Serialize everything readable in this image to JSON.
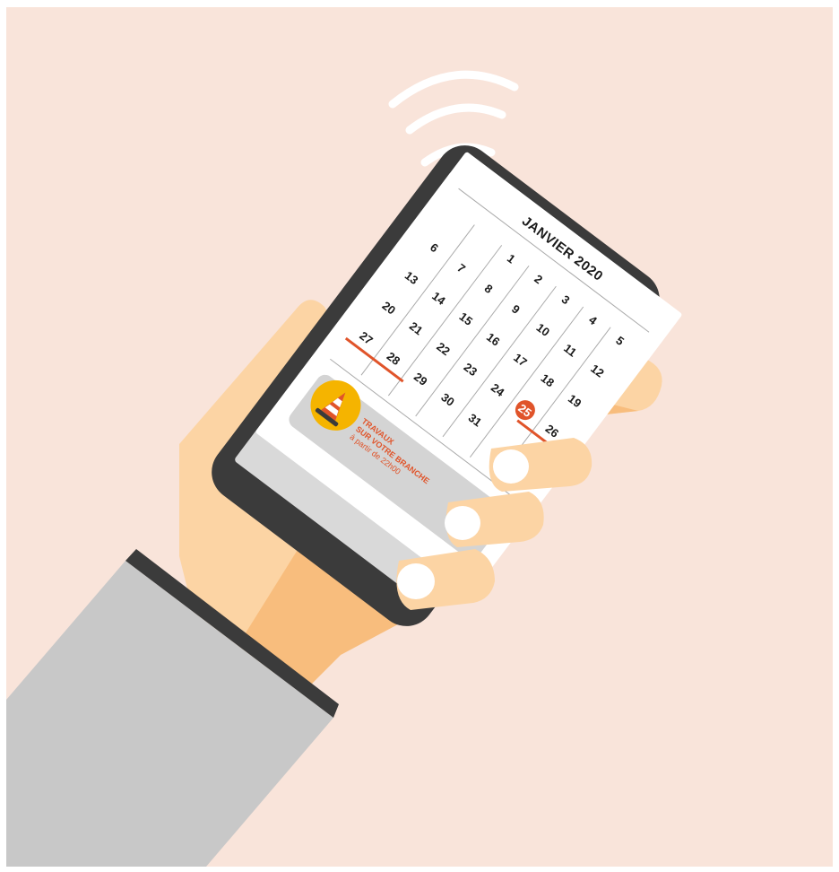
{
  "calendar": {
    "title": "JANVIER 2020",
    "selected_day": "25",
    "weeks": [
      [
        "",
        "",
        "1",
        "2",
        "3",
        "4",
        "5"
      ],
      [
        "6",
        "7",
        "8",
        "9",
        "10",
        "11",
        "12"
      ],
      [
        "13",
        "14",
        "15",
        "16",
        "17",
        "18",
        "19"
      ],
      [
        "20",
        "21",
        "22",
        "23",
        "24",
        "25",
        "26"
      ],
      [
        "27",
        "28",
        "29",
        "30",
        "31",
        "",
        ""
      ]
    ]
  },
  "notification": {
    "line1": "TRAVAUX",
    "line2": "SUR VOTRE BRANCHE",
    "line3": "à partir de 22h00",
    "icon": "traffic-cone-icon"
  },
  "colors": {
    "background": "#f9e4da",
    "phone_body": "#3b3b3b",
    "accent": "#e0542a",
    "cone_circle": "#f5b400",
    "skin": "#fcd4a4",
    "sleeve": "#c8c8c8"
  }
}
